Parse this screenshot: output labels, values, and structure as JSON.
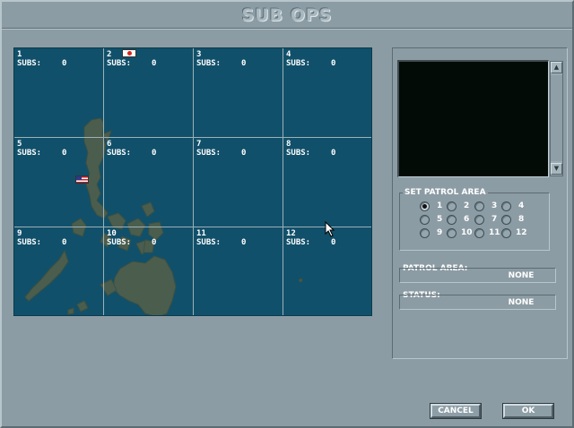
{
  "title": "SUB OPS",
  "map": {
    "cells": [
      {
        "num": "1",
        "subs_label": "SUBS:",
        "count": "0"
      },
      {
        "num": "2",
        "subs_label": "SUBS:",
        "count": "0"
      },
      {
        "num": "3",
        "subs_label": "SUBS:",
        "count": "0"
      },
      {
        "num": "4",
        "subs_label": "SUBS:",
        "count": "0"
      },
      {
        "num": "5",
        "subs_label": "SUBS:",
        "count": "0"
      },
      {
        "num": "6",
        "subs_label": "SUBS:",
        "count": "0"
      },
      {
        "num": "7",
        "subs_label": "SUBS:",
        "count": "0"
      },
      {
        "num": "8",
        "subs_label": "SUBS:",
        "count": "0"
      },
      {
        "num": "9",
        "subs_label": "SUBS:",
        "count": "0"
      },
      {
        "num": "10",
        "subs_label": "SUBS:",
        "count": "0"
      },
      {
        "num": "11",
        "subs_label": "SUBS:",
        "count": "0"
      },
      {
        "num": "12",
        "subs_label": "SUBS:",
        "count": "0"
      }
    ],
    "flags": [
      "japan-flag-icon",
      "usa-flag-icon"
    ]
  },
  "patrol": {
    "group_label": "SET PATROL AREA",
    "options": [
      "1",
      "2",
      "3",
      "4",
      "5",
      "6",
      "7",
      "8",
      "9",
      "10",
      "11",
      "12"
    ],
    "selected": "1"
  },
  "fields": {
    "patrol_area_label": "PATROL AREA:",
    "patrol_area_value": "NONE",
    "status_label": "STATUS:",
    "status_value": "NONE"
  },
  "buttons": {
    "cancel": "CANCEL",
    "ok": "OK"
  },
  "colors": {
    "background": "#8c9ca4",
    "sea": "#11506a",
    "land": "#4b5e4e",
    "screen": "#020b05"
  }
}
